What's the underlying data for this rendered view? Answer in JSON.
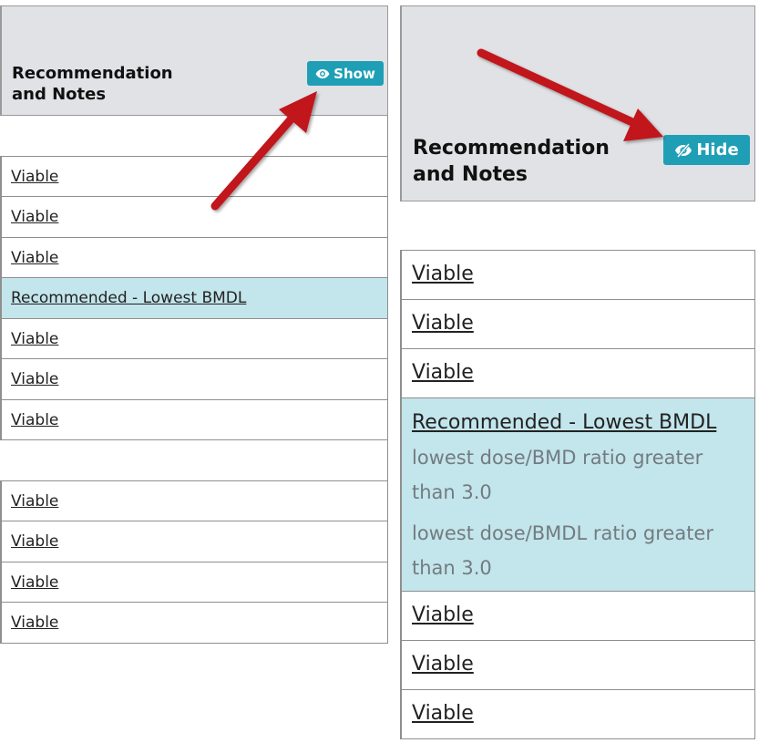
{
  "left_panel": {
    "header": {
      "title_line1": "Recommendation",
      "title_line2": "and Notes",
      "toggle_label": "Show"
    },
    "rows": [
      {
        "label": ""
      },
      {
        "label": "Viable"
      },
      {
        "label": "Viable"
      },
      {
        "label": "Viable"
      },
      {
        "label": "Recommended - Lowest BMDL",
        "highlight": true
      },
      {
        "label": "Viable"
      },
      {
        "label": "Viable"
      },
      {
        "label": "Viable"
      },
      {
        "label": ""
      },
      {
        "label": "Viable"
      },
      {
        "label": "Viable"
      },
      {
        "label": "Viable"
      },
      {
        "label": "Viable"
      }
    ]
  },
  "right_panel": {
    "header": {
      "title_line1": "Recommendation",
      "title_line2": "and Notes",
      "toggle_label": "Hide"
    },
    "rows": [
      {
        "label": ""
      },
      {
        "label": "Viable"
      },
      {
        "label": "Viable"
      },
      {
        "label": "Viable"
      },
      {
        "label": "Recommended - Lowest BMDL",
        "highlight": true,
        "notes": [
          "lowest dose/BMD ratio greater than 3.0",
          "lowest dose/BMDL ratio greater than 3.0"
        ]
      },
      {
        "label": "Viable"
      },
      {
        "label": "Viable"
      },
      {
        "label": "Viable"
      }
    ]
  },
  "colors": {
    "button_bg": "#1f9fb5",
    "header_bg": "#e1e2e5",
    "highlight_bg": "#c3e5ec",
    "arrow": "#c0161d",
    "note_text": "#737b80"
  },
  "icons": {
    "show": "eye-icon",
    "hide": "eye-slash-icon"
  }
}
